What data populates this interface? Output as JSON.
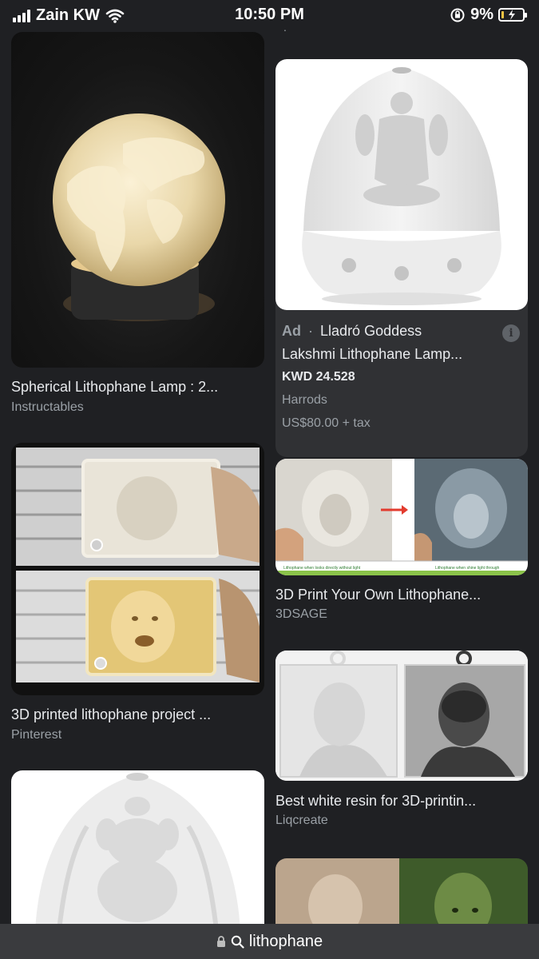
{
  "status_bar": {
    "carrier": "Zain KW",
    "time": "10:50 PM",
    "battery_percent": "9%",
    "battery_level": 0.09
  },
  "results": {
    "left": [
      {
        "title": "Spherical Lithophane Lamp : 2...",
        "source": "Instructables"
      },
      {
        "title": "3D printed lithophane project ...",
        "source": "Pinterest"
      }
    ],
    "right": [
      {
        "title": "3D Print Your Own Lithophane...",
        "source": "3DSAGE",
        "caption_left": "Lithophane when looks directly without light",
        "caption_right": "Lithophane when shine light through"
      },
      {
        "title": "Best white resin for 3D-printin...",
        "source": "Liqcreate"
      }
    ],
    "ad": {
      "ad_label": "Ad",
      "separator": "·",
      "title_line1": "Lladró Goddess",
      "title_line2": "Lakshmi Lithophane Lamp...",
      "price": "KWD 24.528",
      "merchant": "Harrods",
      "alt_price": "US$80.00 + tax",
      "info": "i"
    }
  },
  "address_bar": {
    "url": "lithophane"
  },
  "colors": {
    "background": "#1f2023",
    "ad_card": "#303134",
    "muted_text": "#9aa0a6",
    "battery_fill": "#f5c542"
  }
}
